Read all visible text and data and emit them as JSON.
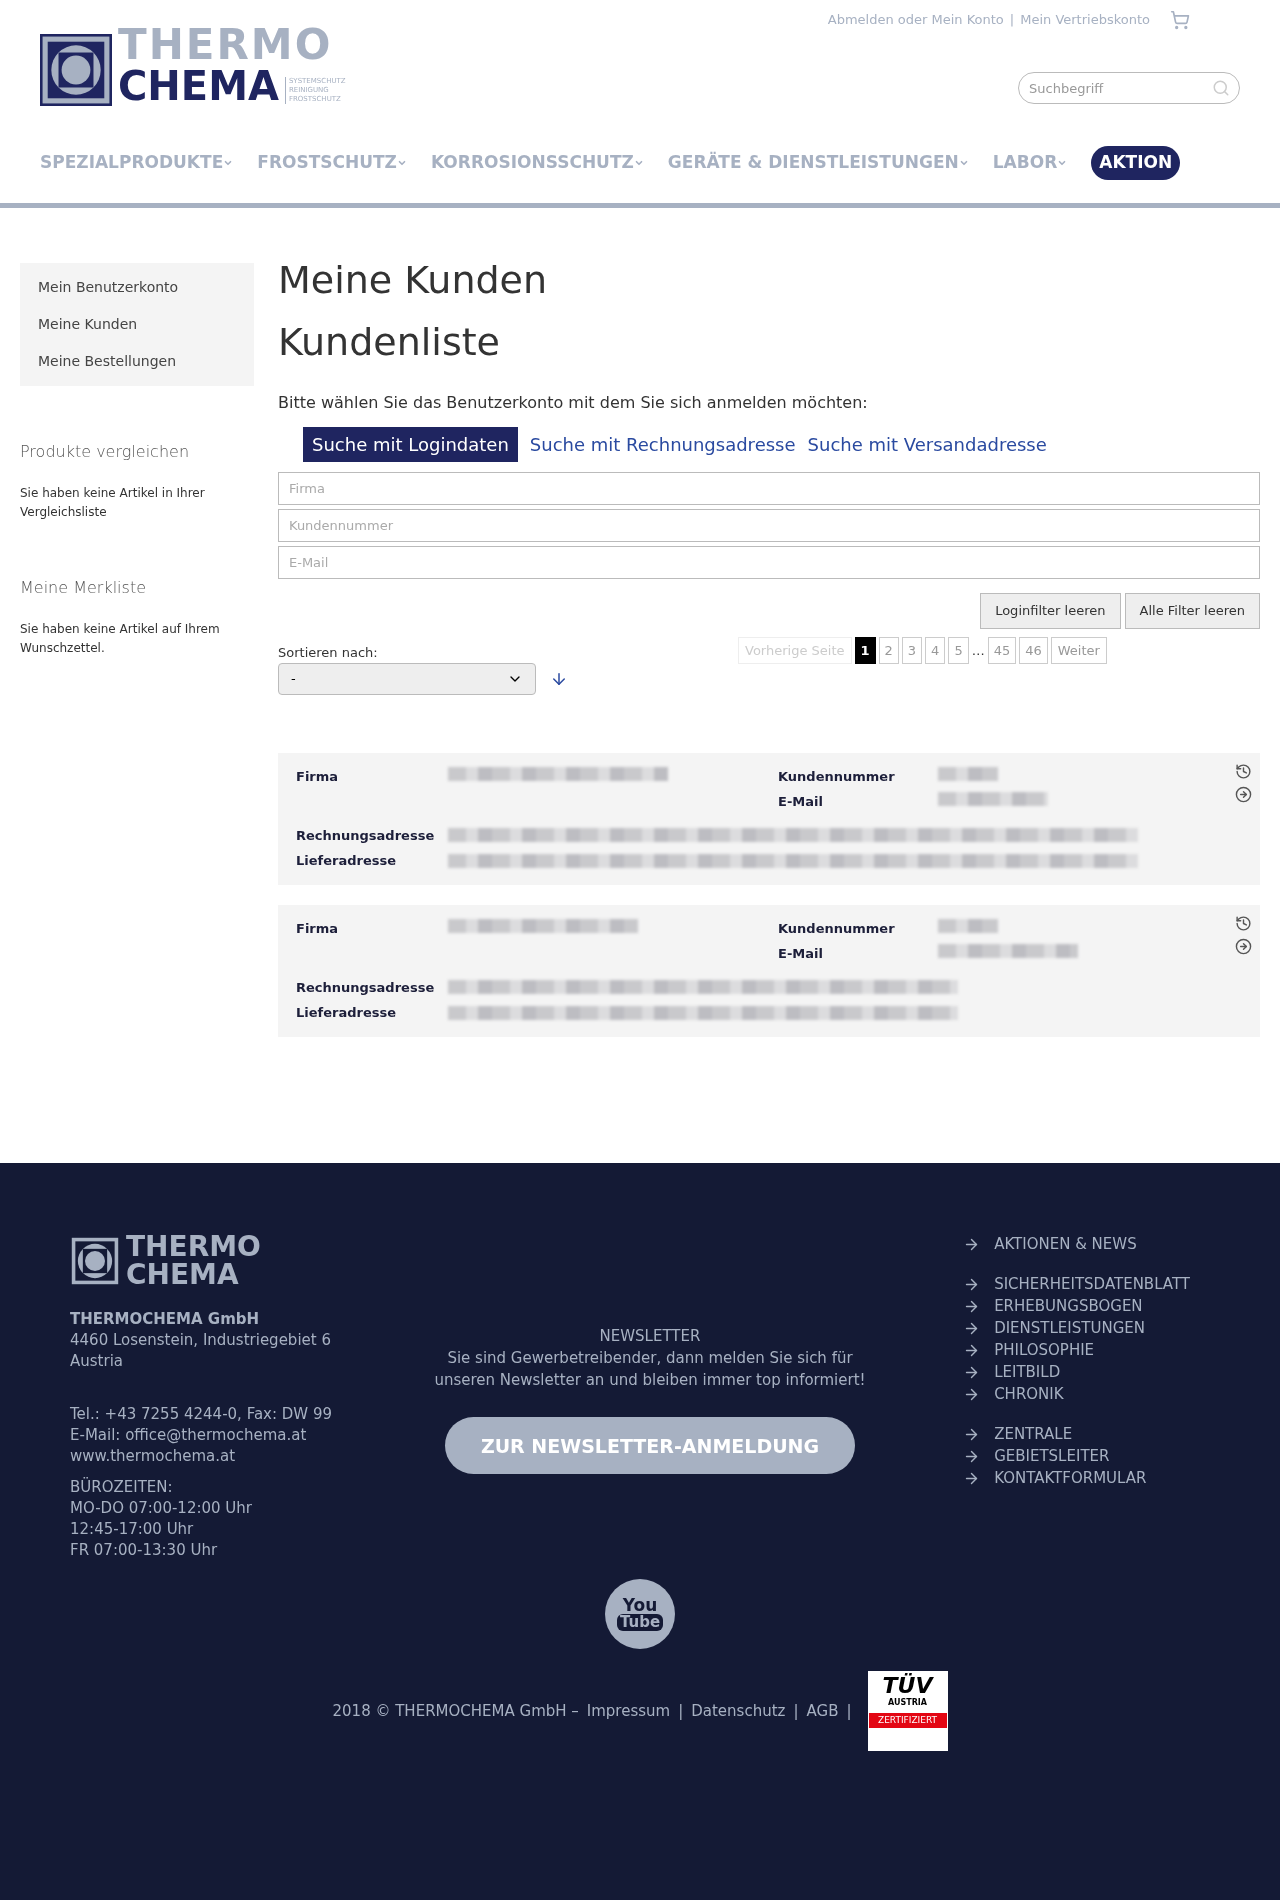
{
  "header": {
    "account_links": [
      "Abmelden oder Mein Konto",
      "Mein Vertriebskonto"
    ],
    "separator": "|",
    "logo": {
      "line1": "THERMO",
      "line2": "CHEMA",
      "tagline": [
        "SYSTEMSCHUTZ",
        "REINIGUNG",
        "FROSTSCHUTZ"
      ]
    },
    "search": {
      "placeholder": "Suchbegriff"
    },
    "nav": [
      {
        "label": "SPEZIALPRODUKTE",
        "kind": "dropdown"
      },
      {
        "label": "FROSTSCHUTZ",
        "kind": "dropdown"
      },
      {
        "label": "KORROSIONSSCHUTZ",
        "kind": "dropdown"
      },
      {
        "label": "GERÄTE & DIENSTLEISTUNGEN",
        "kind": "dropdown"
      },
      {
        "label": "LABOR",
        "kind": "dropdown"
      },
      {
        "label": "AKTION",
        "kind": "highlight"
      }
    ]
  },
  "sidebar": {
    "menu": [
      {
        "label": "Mein Benutzerkonto"
      },
      {
        "label": "Meine Kunden"
      },
      {
        "label": "Meine Bestellungen"
      }
    ],
    "boxes": [
      {
        "title": "Produkte vergleichen",
        "text": "Sie haben keine Artikel in Ihrer Vergleichsliste"
      },
      {
        "title": "Meine Merkliste",
        "text": "Sie haben keine Artikel auf Ihrem Wunschzettel."
      }
    ]
  },
  "main": {
    "title": "Meine Kunden",
    "subtitle": "Kundenliste",
    "instruction": "Bitte wählen Sie das Benutzerkonto mit dem Sie sich anmelden möchten:",
    "tabs": [
      {
        "label": "Suche mit Logindaten",
        "selected": true
      },
      {
        "label": "Suche mit Rechnungsadresse",
        "selected": false
      },
      {
        "label": "Suche mit Versandadresse",
        "selected": false
      }
    ],
    "filters": [
      {
        "placeholder": "Firma"
      },
      {
        "placeholder": "Kundennummer"
      },
      {
        "placeholder": "E-Mail"
      }
    ],
    "buttons": [
      "Loginfilter leeren",
      "Alle Filter leeren"
    ],
    "sort": {
      "label": "Sortieren nach:",
      "value": "-"
    },
    "pagination": {
      "prev": {
        "label": "Vorherige Seite",
        "disabled": true
      },
      "pages": [
        {
          "label": "1",
          "selected": true
        },
        {
          "label": "2",
          "selected": false
        },
        {
          "label": "3",
          "selected": false
        },
        {
          "label": "4",
          "selected": false
        },
        {
          "label": "5",
          "selected": false
        },
        {
          "label": "…",
          "kind": "ellipsis"
        },
        {
          "label": "45",
          "selected": false
        },
        {
          "label": "46",
          "selected": false
        }
      ],
      "next": {
        "label": "Weiter",
        "disabled": false
      }
    },
    "results": [
      {
        "labels": {
          "company": "Firma",
          "number": "Kundennummer",
          "email": "E-Mail",
          "billing": "Rechnungsadresse",
          "delivery": "Lieferadresse"
        }
      },
      {
        "labels": {
          "company": "Firma",
          "number": "Kundennummer",
          "email": "E-Mail",
          "billing": "Rechnungsadresse",
          "delivery": "Lieferadresse"
        }
      }
    ]
  },
  "footer": {
    "logo": {
      "line1": "THERMO",
      "line2": "CHEMA"
    },
    "company": "THERMOCHEMA GmbH",
    "address": [
      "4460 Losenstein, Industriegebiet 6",
      "Austria"
    ],
    "contact": [
      "Tel.: +43 7255 4244-0, Fax: DW 99",
      "E-Mail: office@thermochema.at",
      "www.thermochema.at"
    ],
    "hours": [
      "BÜROZEITEN:",
      "MO-DO 07:00-12:00 Uhr",
      "12:45-17:00 Uhr",
      "FR 07:00-13:30 Uhr"
    ],
    "newsletter": {
      "title": "NEWSLETTER",
      "text": "Sie sind Gewerbetreibender, dann melden Sie sich für unseren Newsletter an und bleiben immer top informiert!",
      "button": "ZUR NEWSLETTER-ANMELDUNG"
    },
    "link_groups": [
      [
        "AKTIONEN & NEWS"
      ],
      [
        "SICHERHEITSDATENBLATT",
        "ERHEBUNGSBOGEN",
        "DIENSTLEISTUNGEN",
        "PHILOSOPHIE",
        "LEITBILD",
        "CHRONIK"
      ],
      [
        "ZENTRALE",
        "GEBIETSLEITER",
        "KONTAKTFORMULAR"
      ]
    ],
    "youtube": [
      "You",
      "Tube"
    ],
    "copyright": "2018 © THERMOCHEMA GmbH –",
    "legal_links": [
      "Impressum",
      "Datenschutz",
      "AGB"
    ],
    "separator": "|",
    "badge": {
      "brand": "TÜV",
      "country": "AUSTRIA",
      "note": "ZERTIFIZIERT"
    }
  }
}
